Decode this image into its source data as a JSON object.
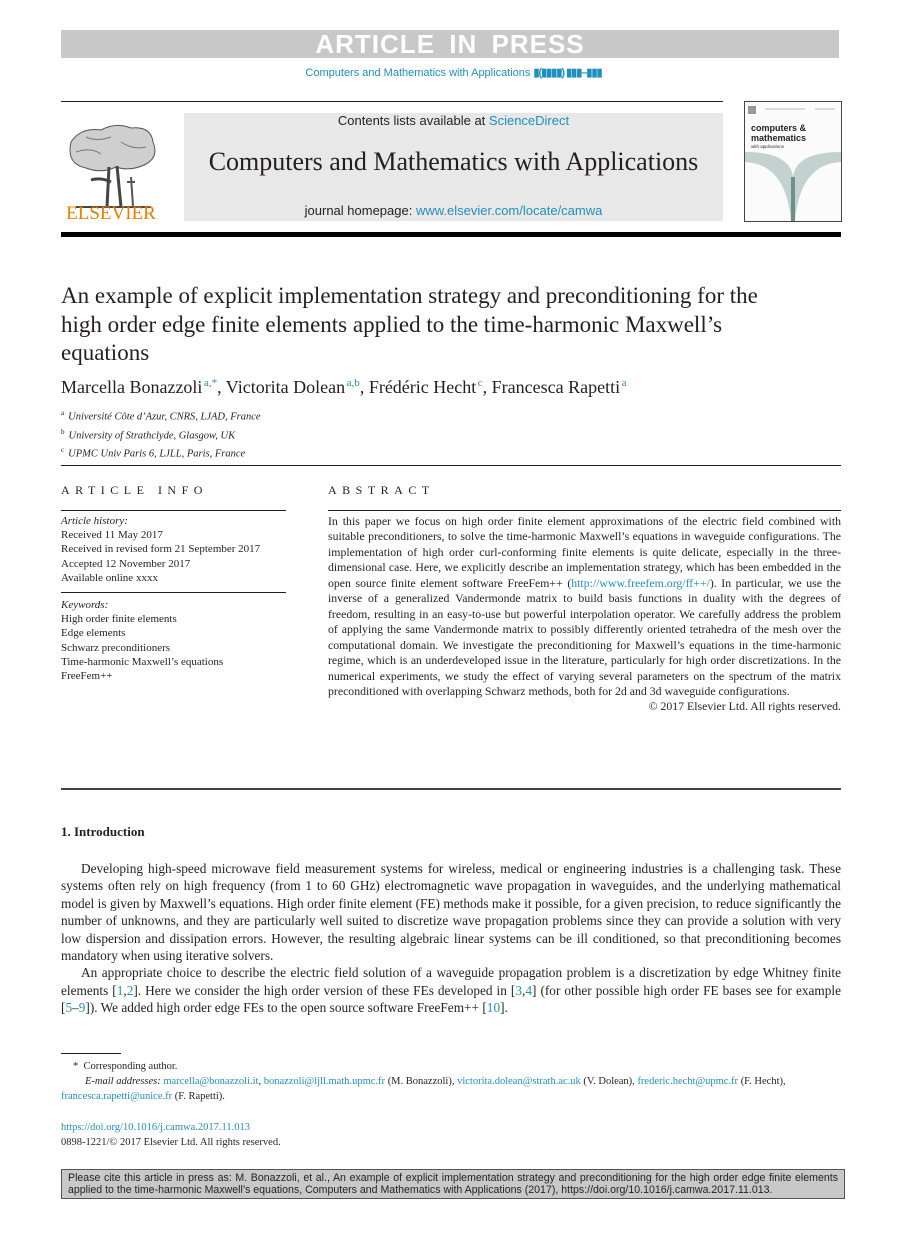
{
  "banner": {
    "text": "ARTICLE IN PRESS"
  },
  "running_head": {
    "journal": "Computers and Mathematics with Applications",
    "volume_placeholder": "▮(▮▮▮▮) ▮▮▮–▮▮▮"
  },
  "masthead": {
    "publisher_logo_text": "ELSEVIER",
    "contents_prefix": "Contents lists available at ",
    "contents_link": "ScienceDirect",
    "journal_name": "Computers and Mathematics with Applications",
    "homepage_prefix": "journal homepage: ",
    "homepage_link": "www.elsevier.com/locate/camwa",
    "cover": {
      "line1": "computers &",
      "line2": "mathematics",
      "line3": "with applications"
    }
  },
  "article": {
    "title": "An example of explicit implementation strategy and preconditioning for the high order edge finite elements applied to the time-harmonic Maxwell’s equations",
    "authors": [
      {
        "name": "Marcella Bonazzoli",
        "marks": "a,*"
      },
      {
        "name": "Victorita Dolean",
        "marks": "a,b"
      },
      {
        "name": "Frédéric Hecht",
        "marks": "c"
      },
      {
        "name": "Francesca Rapetti",
        "marks": "a"
      }
    ],
    "affiliations": [
      {
        "mark": "a",
        "text": "Université Côte d’Azur, CNRS, LJAD, France"
      },
      {
        "mark": "b",
        "text": "University of Strathclyde, Glasgow, UK"
      },
      {
        "mark": "c",
        "text": "UPMC Univ Paris 6, LJLL, Paris, France"
      }
    ]
  },
  "article_info": {
    "heading": "ARTICLE INFO",
    "history_label": "Article history:",
    "history": [
      "Received 11 May 2017",
      "Received in revised form 21 September 2017",
      "Accepted 12 November 2017",
      "Available online xxxx"
    ],
    "keywords_label": "Keywords:",
    "keywords": [
      "High order finite elements",
      "Edge elements",
      "Schwarz preconditioners",
      "Time-harmonic Maxwell’s equations",
      "FreeFem++"
    ]
  },
  "abstract": {
    "heading": "ABSTRACT",
    "text_before_link": "In this paper we focus on high order finite element approximations of the electric field combined with suitable preconditioners, to solve the time-harmonic Maxwell’s equations in waveguide configurations. The implementation of high order curl-conforming finite elements is quite delicate, especially in the three-dimensional case. Here, we explicitly describe an implementation strategy, which has been embedded in the open source finite element software FreeFem++ (",
    "link": "http://www.freefem.org/ff++/",
    "text_after_link": "). In particular, we use the inverse of a generalized Vandermonde matrix to build basis functions in duality with the degrees of freedom, resulting in an easy-to-use but powerful interpolation operator. We carefully address the problem of applying the same Vandermonde matrix to possibly differently oriented tetrahedra of the mesh over the computational domain. We investigate the preconditioning for Maxwell’s equations in the time-harmonic regime, which is an underdeveloped issue in the literature, particularly for high order discretizations. In the numerical experiments, we study the effect of varying several parameters on the spectrum of the matrix preconditioned with overlapping Schwarz methods, both for 2d and 3d waveguide configurations.",
    "copyright": "© 2017 Elsevier Ltd. All rights reserved."
  },
  "introduction": {
    "heading": "1.  Introduction",
    "p1": "Developing high-speed microwave field measurement systems for wireless, medical or engineering industries is a challenging task. These systems often rely on high frequency (from 1 to 60 GHz) electromagnetic wave propagation in waveguides, and the underlying mathematical model is given by Maxwell’s equations. High order finite element (FE) methods make it possible, for a given precision, to reduce significantly the number of unknowns, and they are particularly well suited to discretize wave propagation problems since they can provide a solution with very low dispersion and dissipation errors. However, the resulting algebraic linear systems can be ill conditioned, so that preconditioning becomes mandatory when using iterative solvers.",
    "p2_a": "An appropriate choice to describe the electric field solution of a waveguide propagation problem is a discretization by edge Whitney finite elements [",
    "ref1": "1",
    "ref2": "2",
    "p2_b": "]. Here we consider the high order version of these FEs developed in [",
    "ref3": "3",
    "ref4": "4",
    "p2_c": "] (for other possible high order FE bases see for example [",
    "ref5": "5",
    "ref9": "9",
    "p2_d": "]). We added high order edge FEs to the open source software FreeFem++ [",
    "ref10": "10",
    "p2_e": "]."
  },
  "footnotes": {
    "corresponding": "Corresponding author.",
    "email_label": "E-mail addresses:",
    "emails": [
      {
        "address": "marcella@bonazzoli.it",
        "owner": ""
      },
      {
        "address": "bonazzoli@ljll.math.upmc.fr",
        "owner": "(M. Bonazzoli),"
      },
      {
        "address": "victorita.dolean@strath.ac.uk",
        "owner": "(V. Dolean),"
      },
      {
        "address": "frederic.hecht@upmc.fr",
        "owner": "(F. Hecht),"
      },
      {
        "address": "francesca.rapetti@unice.fr",
        "owner": "(F. Rapetti)."
      }
    ]
  },
  "doi": {
    "link": "https://doi.org/10.1016/j.camwa.2017.11.013",
    "issn_line": "0898-1221/© 2017 Elsevier Ltd. All rights reserved."
  },
  "citation_box": {
    "text": "Please cite this article in press as: M. Bonazzoli, et al., An example of explicit implementation strategy and preconditioning for the high order edge finite elements applied to the time-harmonic Maxwell’s equations, Computers and Mathematics with Applications (2017), https://doi.org/10.1016/j.camwa.2017.11.013."
  },
  "colors": {
    "link": "#1f8fc0",
    "elsevier_orange": "#f07c00",
    "banner_gray": "#c8c8c8",
    "masthead_gray": "#e8e8e8"
  }
}
